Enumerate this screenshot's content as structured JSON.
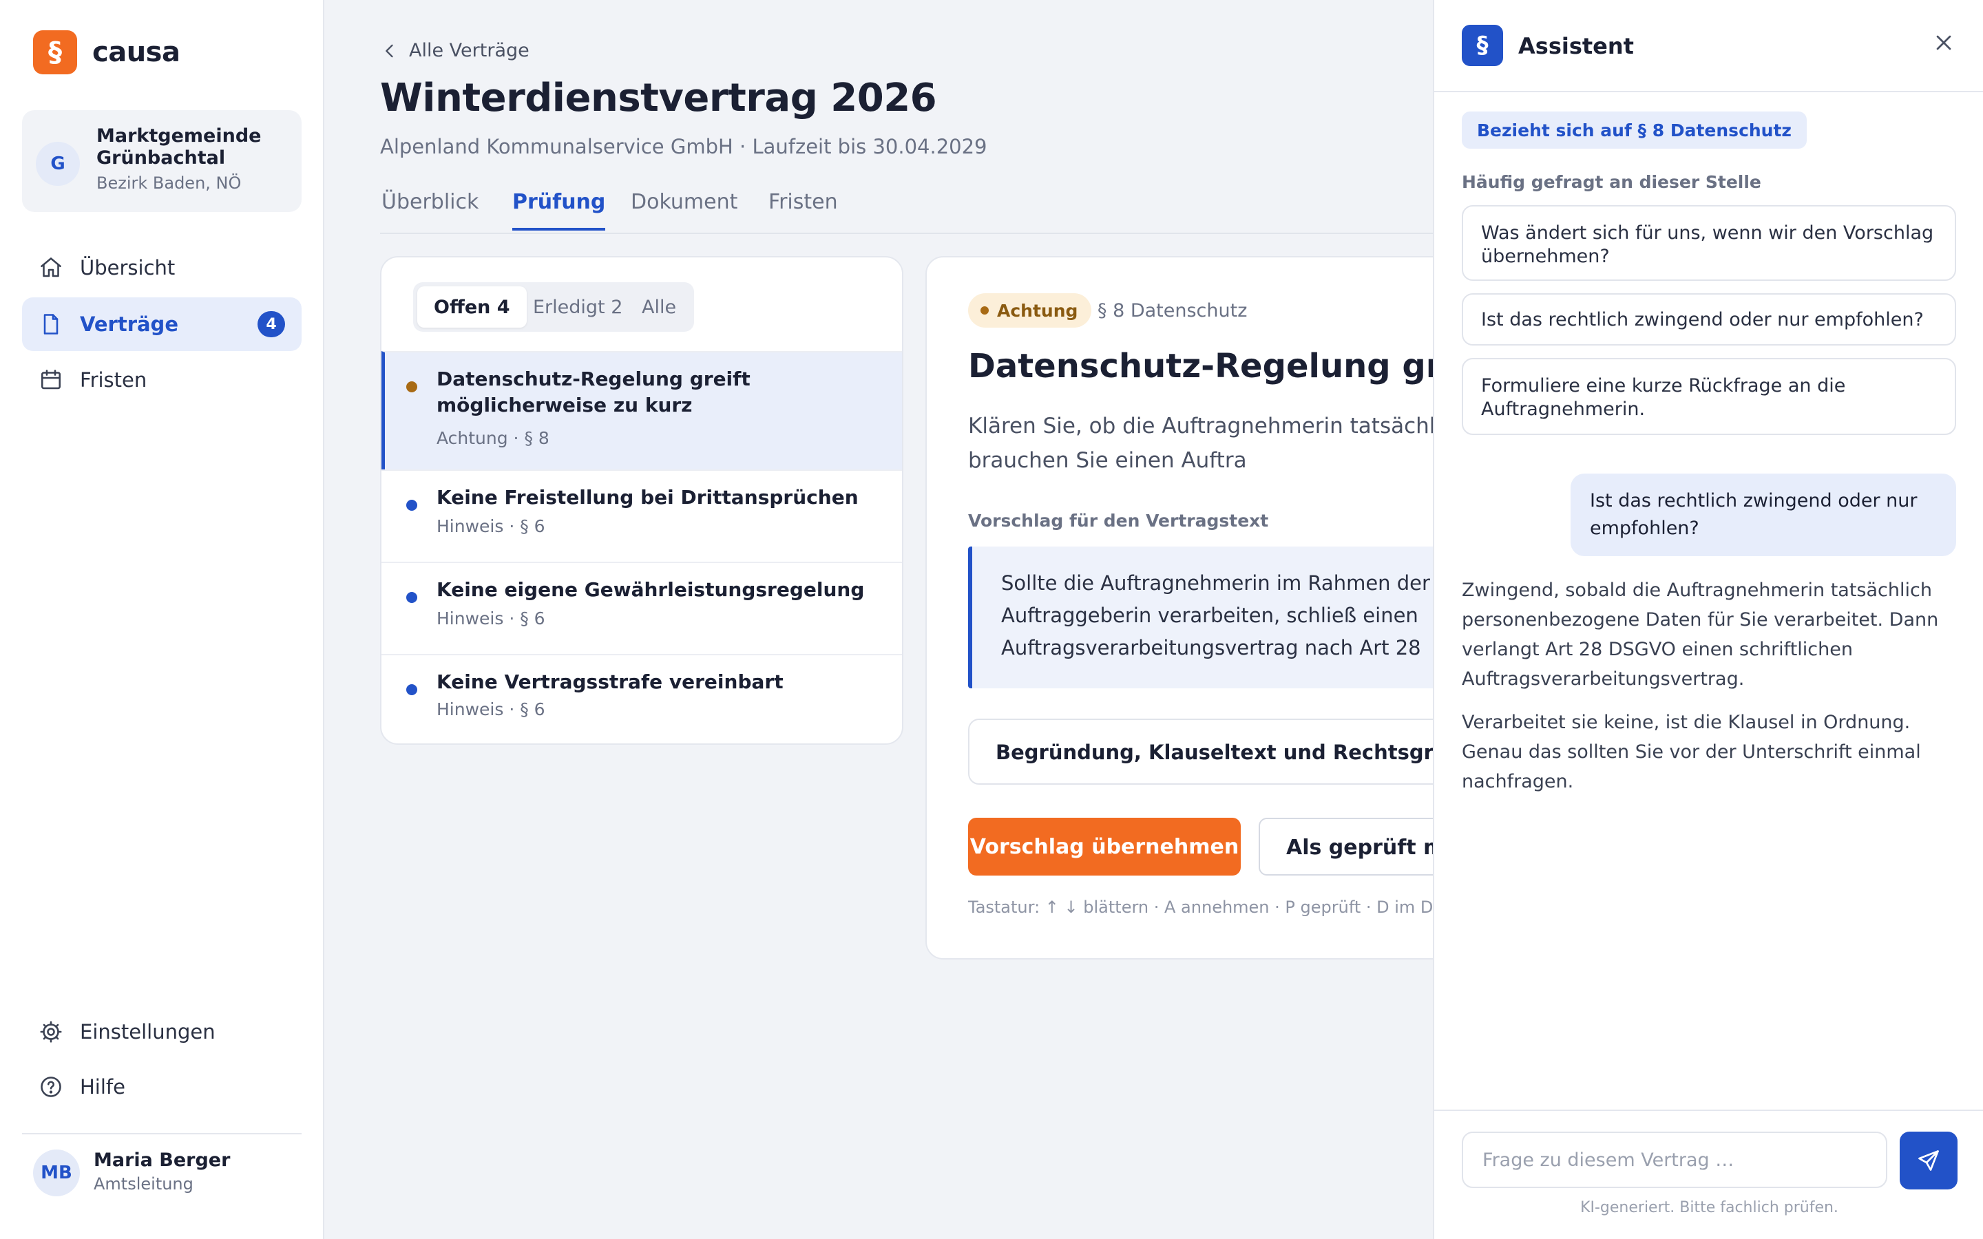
{
  "app": {
    "logo_glyph": "§",
    "name": "causa",
    "brand_color": "#f26b21",
    "accent_color": "#2252c8"
  },
  "org": {
    "initial": "G",
    "name": "Marktgemeinde Grünbachtal",
    "region": "Bezirk Baden, NÖ"
  },
  "nav": {
    "items": [
      {
        "label": "Übersicht",
        "icon": "home-icon"
      },
      {
        "label": "Verträge",
        "icon": "document-icon",
        "badge": "4",
        "active": true
      },
      {
        "label": "Fristen",
        "icon": "calendar-icon"
      }
    ],
    "bottom": [
      {
        "label": "Einstellungen",
        "icon": "gear-icon"
      },
      {
        "label": "Hilfe",
        "icon": "help-icon"
      }
    ]
  },
  "user": {
    "initials": "MB",
    "name": "Maria Berger",
    "role": "Amtsleitung"
  },
  "header": {
    "back_label": "Alle Verträge",
    "title": "Winterdienstvertrag 2026",
    "subtitle": "Alpenland Kommunalservice GmbH · Laufzeit bis 30.04.2029",
    "tabs": [
      {
        "label": "Überblick"
      },
      {
        "label": "Prüfung",
        "active": true
      },
      {
        "label": "Dokument"
      },
      {
        "label": "Fristen"
      }
    ]
  },
  "issues": {
    "filters": [
      {
        "label": "Offen 4",
        "active": true
      },
      {
        "label": "Erledigt 2"
      },
      {
        "label": "Alle"
      }
    ],
    "items": [
      {
        "title": "Datenschutz-Regelung greift möglicherweise zu kurz",
        "meta": "Achtung · § 8",
        "severity": "warning",
        "color": "#a86a14",
        "selected": true
      },
      {
        "title": "Keine Freistellung bei Drittansprüchen",
        "meta": "Hinweis · § 6",
        "severity": "info",
        "color": "#2252c8"
      },
      {
        "title": "Keine eigene Gewährleistungsregelung",
        "meta": "Hinweis · § 6",
        "severity": "info",
        "color": "#2252c8"
      },
      {
        "title": "Keine Vertragsstrafe vereinbart",
        "meta": "Hinweis · § 6",
        "severity": "info",
        "color": "#2252c8"
      }
    ]
  },
  "detail": {
    "badge": "Achtung",
    "section": "§ 8 Datenschutz",
    "title": "Datenschutz-Regelung greift",
    "text": "Klären Sie, ob die Auftragnehmerin tatsächlich p verarbeitet. Wenn ja, brauchen Sie einen Auftra",
    "suggestion_label": "Vorschlag für den Vertragstext",
    "suggestion_text": "Sollte die Auftragnehmerin im Rahmen der Leis Auftrag der Auftraggeberin verarbeiten, schließ einen Auftragsverarbeitungsvertrag nach Art 28",
    "disclosure_label": "Begründung, Klauseltext und Rechtsgrundlage",
    "accept_button": "Vorschlag übernehmen",
    "reviewed_button": "Als geprüft mar",
    "keyboard_hint": "Tastatur: ↑ ↓ blättern · A annehmen · P geprüft · D im Doku"
  },
  "assistant": {
    "logo_glyph": "§",
    "title": "Assistent",
    "reference_chip": "Bezieht sich auf § 8 Datenschutz",
    "faq_label": "Häufig gefragt an dieser Stelle",
    "faqs": [
      "Was ändert sich für uns, wenn wir den Vorschlag übernehmen?",
      "Ist das rechtlich zwingend oder nur empfohlen?",
      "Formuliere eine kurze Rückfrage an die Auftragnehmerin."
    ],
    "user_message": "Ist das rechtlich zwingend oder nur empfohlen?",
    "answer_paragraphs": [
      "Zwingend, sobald die Auftragnehmerin tatsächlich personenbezogene Daten für Sie verarbeitet. Dann verlangt Art 28 DSGVO einen schriftlichen Auftragsverarbeitungsvertrag.",
      "Verarbeitet sie keine, ist die Klausel in Ordnung. Genau das sollten Sie vor der Unterschrift einmal nachfragen."
    ],
    "input_placeholder": "Frage zu diesem Vertrag …",
    "input_value": "",
    "ai_note": "KI-generiert. Bitte fachlich prüfen."
  }
}
